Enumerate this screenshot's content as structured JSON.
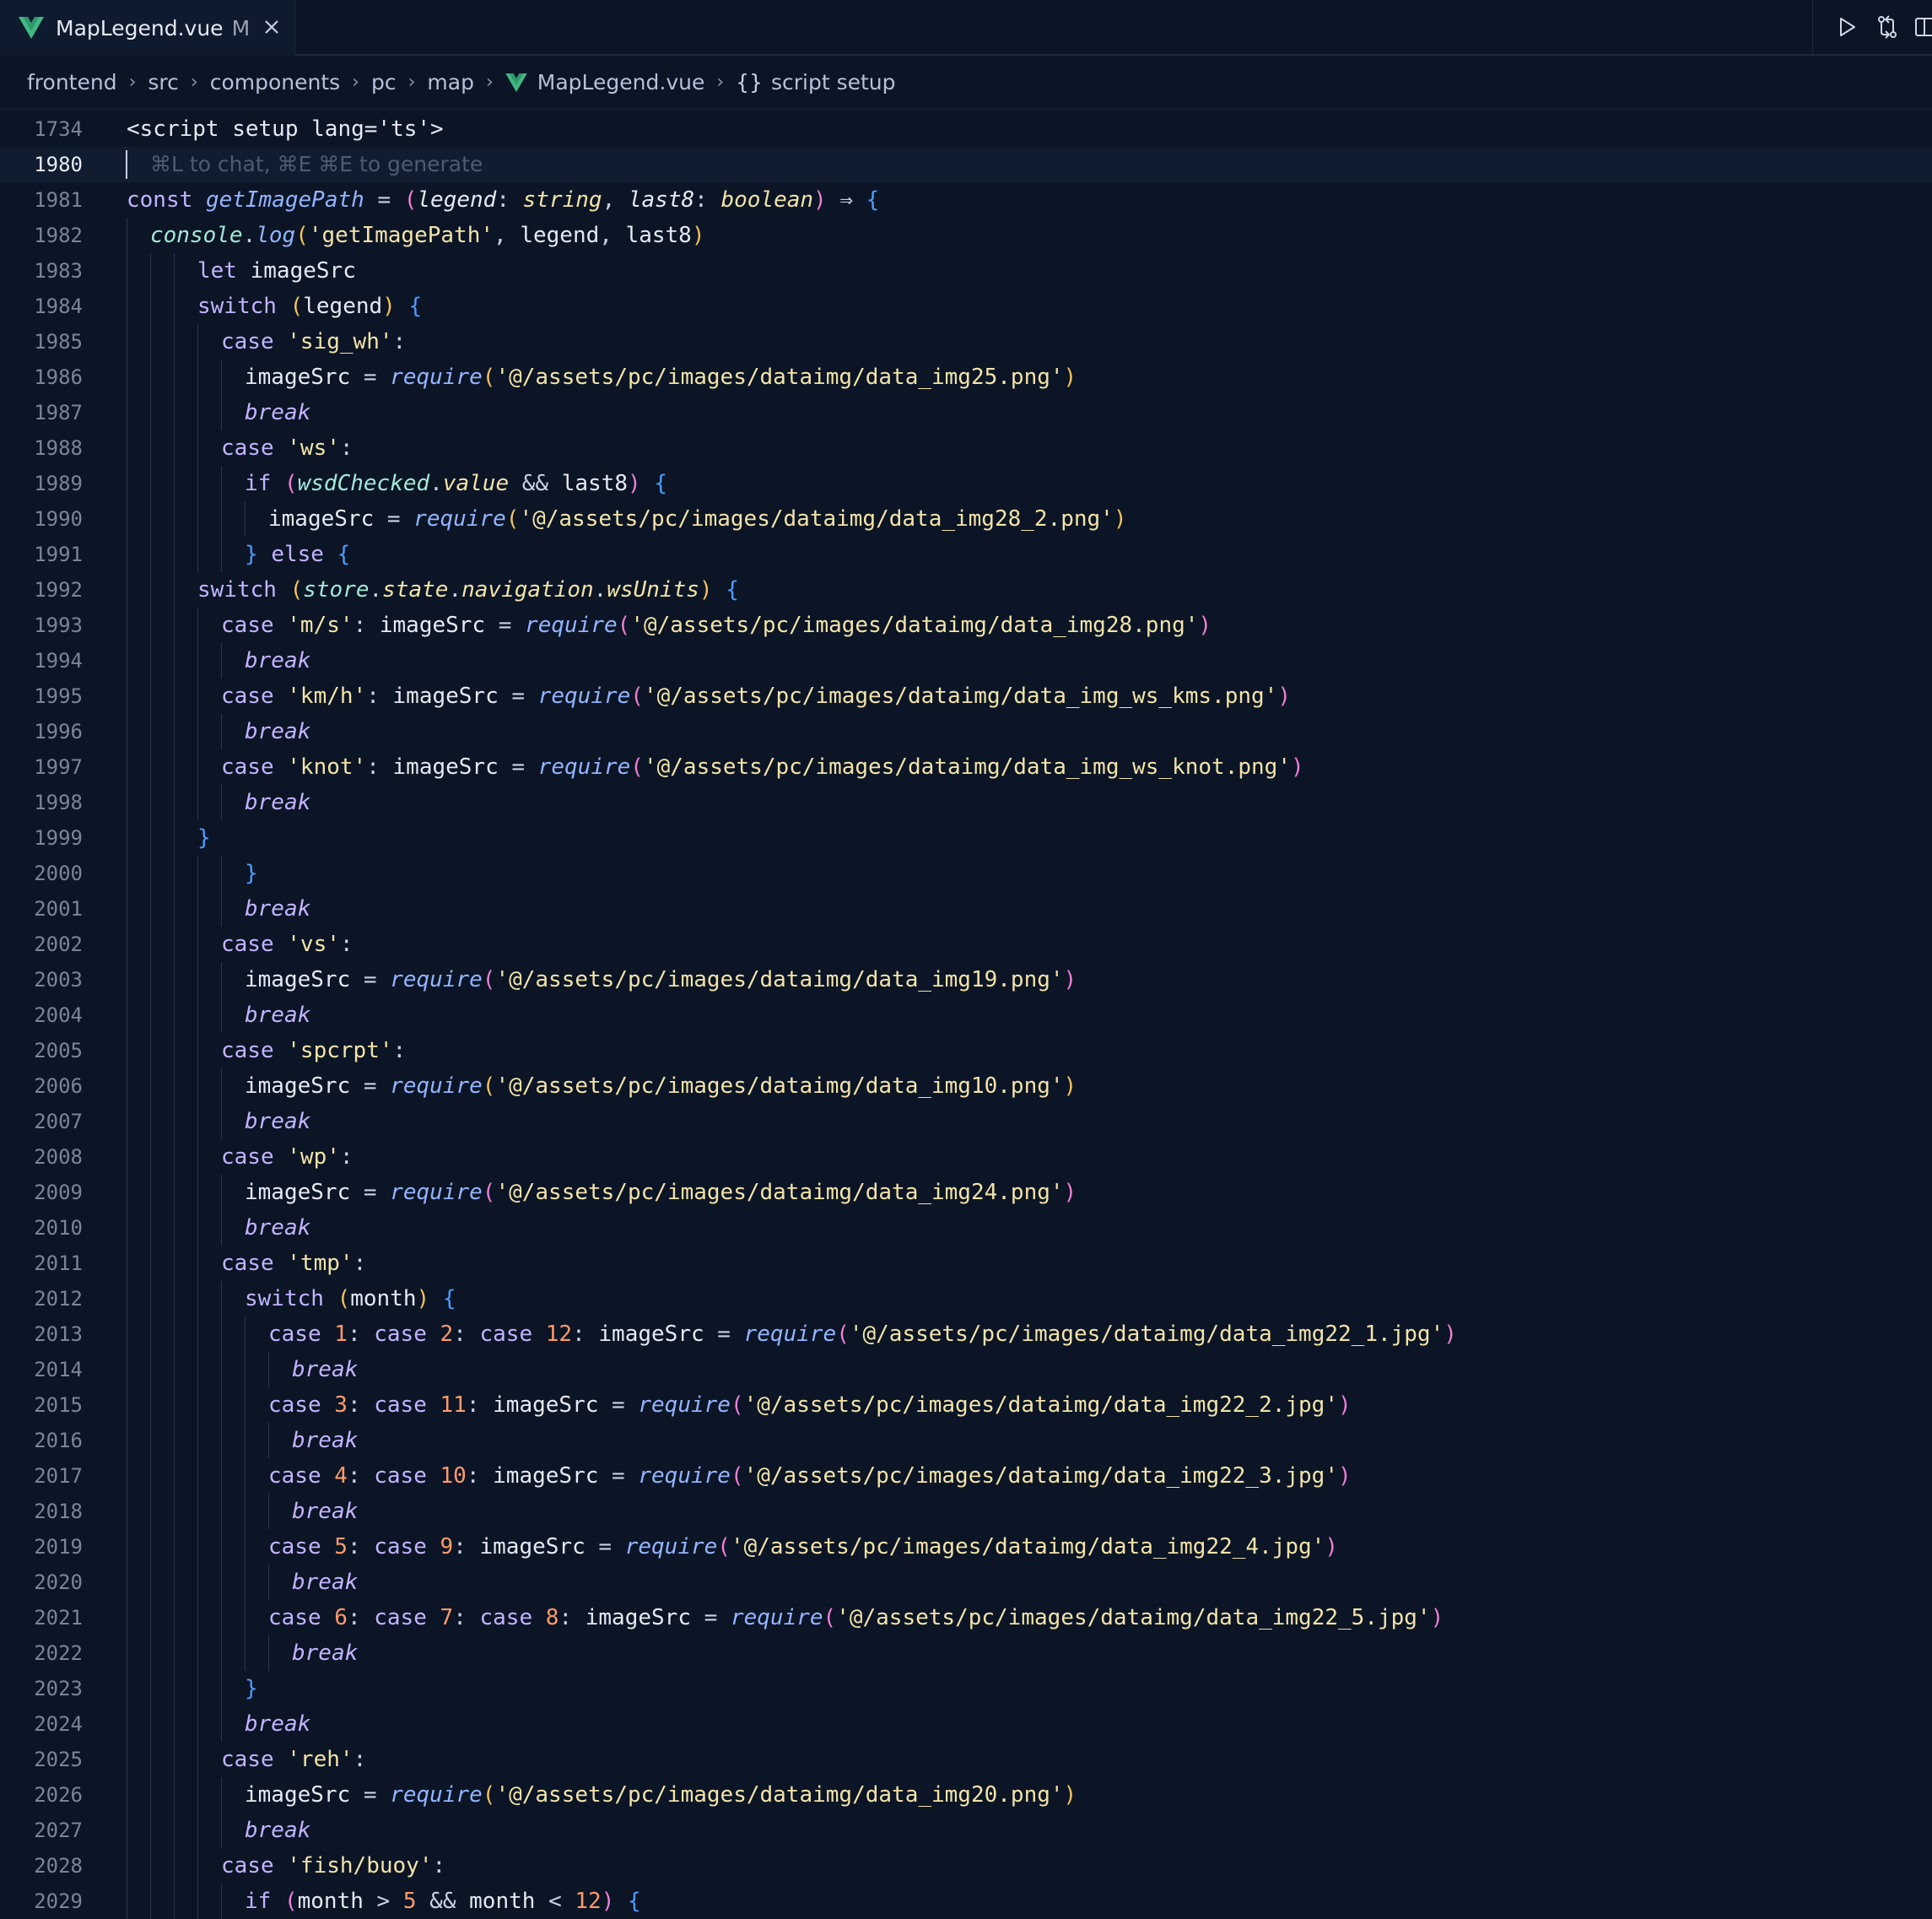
{
  "tab": {
    "filename": "MapLegend.vue",
    "modified_marker": "M"
  },
  "icons": [
    "vue-logo-icon",
    "close-icon",
    "run-icon",
    "source-control-compare-icon",
    "split-editor-icon",
    "chevron-right-icon"
  ],
  "colors": {
    "background": "#0b1526",
    "vue_green": "#42b883",
    "keyword": "#c3b3ff",
    "string": "#f3e3a8",
    "function": "#93b4ff"
  },
  "breadcrumb": {
    "items": [
      "frontend",
      "src",
      "components",
      "pc",
      "map",
      "MapLegend.vue",
      "script setup"
    ]
  },
  "editor": {
    "active_line": "1980",
    "ghost_hint": "⌘L to chat, ⌘E ⌘E to generate",
    "lines": [
      {
        "n": "1734",
        "indent": 0,
        "text": "<script setup lang='ts'>"
      },
      {
        "n": "1980",
        "indent": 0,
        "text": ""
      },
      {
        "n": "1981",
        "indent": 0,
        "text": "const getImagePath = (legend: string, last8: boolean) ⇒ {"
      },
      {
        "n": "1982",
        "indent": 1,
        "text": "console.log('getImagePath', legend, last8)"
      },
      {
        "n": "1983",
        "indent": 3,
        "text": "let imageSrc"
      },
      {
        "n": "1984",
        "indent": 3,
        "text": "switch (legend) {"
      },
      {
        "n": "1985",
        "indent": 4,
        "text": "case 'sig_wh':"
      },
      {
        "n": "1986",
        "indent": 5,
        "text": "imageSrc = require('@/assets/pc/images/dataimg/data_img25.png')"
      },
      {
        "n": "1987",
        "indent": 5,
        "text": "break"
      },
      {
        "n": "1988",
        "indent": 4,
        "text": "case 'ws':"
      },
      {
        "n": "1989",
        "indent": 5,
        "text": "if (wsdChecked.value && last8) {"
      },
      {
        "n": "1990",
        "indent": 6,
        "text": "imageSrc = require('@/assets/pc/images/dataimg/data_img28_2.png')"
      },
      {
        "n": "1991",
        "indent": 5,
        "text": "} else {"
      },
      {
        "n": "1992",
        "indent": 3,
        "text": "switch (store.state.navigation.wsUnits) {"
      },
      {
        "n": "1993",
        "indent": 4,
        "text": "case 'm/s': imageSrc = require('@/assets/pc/images/dataimg/data_img28.png')"
      },
      {
        "n": "1994",
        "indent": 5,
        "text": "break"
      },
      {
        "n": "1995",
        "indent": 4,
        "text": "case 'km/h': imageSrc = require('@/assets/pc/images/dataimg/data_img_ws_kms.png')"
      },
      {
        "n": "1996",
        "indent": 5,
        "text": "break"
      },
      {
        "n": "1997",
        "indent": 4,
        "text": "case 'knot': imageSrc = require('@/assets/pc/images/dataimg/data_img_ws_knot.png')"
      },
      {
        "n": "1998",
        "indent": 5,
        "text": "break"
      },
      {
        "n": "1999",
        "indent": 3,
        "text": "}"
      },
      {
        "n": "2000",
        "indent": 5,
        "text": "}"
      },
      {
        "n": "2001",
        "indent": 5,
        "text": "break"
      },
      {
        "n": "2002",
        "indent": 4,
        "text": "case 'vs':"
      },
      {
        "n": "2003",
        "indent": 5,
        "text": "imageSrc = require('@/assets/pc/images/dataimg/data_img19.png')"
      },
      {
        "n": "2004",
        "indent": 5,
        "text": "break"
      },
      {
        "n": "2005",
        "indent": 4,
        "text": "case 'spcrpt':"
      },
      {
        "n": "2006",
        "indent": 5,
        "text": "imageSrc = require('@/assets/pc/images/dataimg/data_img10.png')"
      },
      {
        "n": "2007",
        "indent": 5,
        "text": "break"
      },
      {
        "n": "2008",
        "indent": 4,
        "text": "case 'wp':"
      },
      {
        "n": "2009",
        "indent": 5,
        "text": "imageSrc = require('@/assets/pc/images/dataimg/data_img24.png')"
      },
      {
        "n": "2010",
        "indent": 5,
        "text": "break"
      },
      {
        "n": "2011",
        "indent": 4,
        "text": "case 'tmp':"
      },
      {
        "n": "2012",
        "indent": 5,
        "text": "switch (month) {"
      },
      {
        "n": "2013",
        "indent": 6,
        "text": "case 1: case 2: case 12: imageSrc = require('@/assets/pc/images/dataimg/data_img22_1.jpg')"
      },
      {
        "n": "2014",
        "indent": 7,
        "text": "break"
      },
      {
        "n": "2015",
        "indent": 6,
        "text": "case 3: case 11: imageSrc = require('@/assets/pc/images/dataimg/data_img22_2.jpg')"
      },
      {
        "n": "2016",
        "indent": 7,
        "text": "break"
      },
      {
        "n": "2017",
        "indent": 6,
        "text": "case 4: case 10: imageSrc = require('@/assets/pc/images/dataimg/data_img22_3.jpg')"
      },
      {
        "n": "2018",
        "indent": 7,
        "text": "break"
      },
      {
        "n": "2019",
        "indent": 6,
        "text": "case 5: case 9: imageSrc = require('@/assets/pc/images/dataimg/data_img22_4.jpg')"
      },
      {
        "n": "2020",
        "indent": 7,
        "text": "break"
      },
      {
        "n": "2021",
        "indent": 6,
        "text": "case 6: case 7: case 8: imageSrc = require('@/assets/pc/images/dataimg/data_img22_5.jpg')"
      },
      {
        "n": "2022",
        "indent": 7,
        "text": "break"
      },
      {
        "n": "2023",
        "indent": 5,
        "text": "}"
      },
      {
        "n": "2024",
        "indent": 5,
        "text": "break"
      },
      {
        "n": "2025",
        "indent": 4,
        "text": "case 'reh':"
      },
      {
        "n": "2026",
        "indent": 5,
        "text": "imageSrc = require('@/assets/pc/images/dataimg/data_img20.png')"
      },
      {
        "n": "2027",
        "indent": 5,
        "text": "break"
      },
      {
        "n": "2028",
        "indent": 4,
        "text": "case 'fish/buoy':"
      },
      {
        "n": "2029",
        "indent": 5,
        "text": "if (month > 5 && month < 12) {"
      }
    ]
  }
}
